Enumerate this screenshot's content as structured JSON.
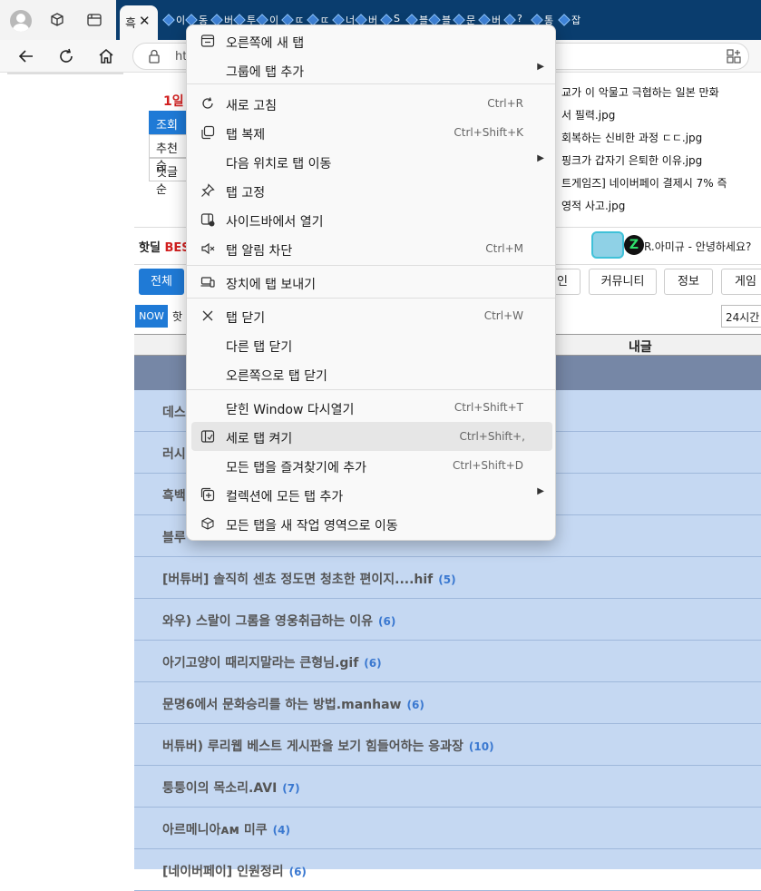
{
  "tabstrip": {
    "active_tab_char": "흑",
    "active_tab_close": "✕",
    "mini_tabs": [
      "이",
      "동",
      "버",
      "투",
      "이",
      "ㄸ",
      "ㄸ",
      "너",
      "버",
      "S",
      "블",
      "블",
      "문",
      "버",
      "?",
      "통",
      "잡"
    ]
  },
  "toolbar": {
    "url_partial": "htt"
  },
  "page": {
    "rank_label": "1일",
    "sort": [
      "조회순",
      "추천순",
      "댓글순"
    ],
    "news": [
      "교가 이 악물고 극협하는 일본 만화",
      "서 필력.jpg",
      "회복하는 신비한 과정 ㄷㄷ.jpg",
      "핑크가 갑자기 은퇴한 이유.jpg",
      "트게임즈] 네이버페이 결제시 7% 즉",
      "영적 사고.jpg"
    ],
    "hotdeal_label_a": "핫딜 ",
    "hotdeal_label_b": "BEST",
    "hotdeal_msg": "R.아미규 - 안녕하세요?",
    "zbadge": "Z",
    "cats": [
      "전체",
      "인",
      "커뮤니티",
      "정보",
      "게임"
    ],
    "now_label": "NOW",
    "now_text": "핫",
    "hours": "24시간",
    "table_header": "내글",
    "rows": [
      {
        "title": "데스",
        "count": ""
      },
      {
        "title": "러시",
        "count": ""
      },
      {
        "title": "흑백",
        "count": ""
      },
      {
        "title": "블루",
        "count": ""
      },
      {
        "title": "[버튜버] 솔직히 센쵸 정도면 청초한 편이지....hif",
        "count": "(5)"
      },
      {
        "title": "와우) 스랄이 그롬을 영웅취급하는 이유",
        "count": "(6)"
      },
      {
        "title": "아기고양이 때리지말라는 큰형님.gif",
        "count": "(6)"
      },
      {
        "title": "문명6에서 문화승리를 하는 방법.manhaw",
        "count": "(6)"
      },
      {
        "title": "버튜버) 루리웹 베스트 게시판을 보기 힘들어하는 응과장",
        "count": "(10)"
      },
      {
        "title": "퉁퉁이의 목소리.AVI",
        "count": "(7)"
      },
      {
        "title": "아르메니아ᴀᴍ 미쿠",
        "count": "(4)"
      },
      {
        "title": "[네이버페이] 인원정리",
        "count": "(6)"
      }
    ]
  },
  "context_menu": {
    "items": [
      {
        "label": "오른쪽에 새 탭",
        "shortcut": "",
        "submenu": false,
        "icon": "new-tab-icon"
      },
      {
        "label": "그룹에 탭 추가",
        "shortcut": "",
        "submenu": true,
        "icon": ""
      },
      {
        "label": "새로 고침",
        "shortcut": "Ctrl+R",
        "submenu": false,
        "icon": "refresh-icon"
      },
      {
        "label": "탭 복제",
        "shortcut": "Ctrl+Shift+K",
        "submenu": false,
        "icon": "duplicate-icon"
      },
      {
        "label": "다음 위치로 탭 이동",
        "shortcut": "",
        "submenu": true,
        "icon": ""
      },
      {
        "label": "탭 고정",
        "shortcut": "",
        "submenu": false,
        "icon": "pin-icon"
      },
      {
        "label": "사이드바에서 열기",
        "shortcut": "",
        "submenu": false,
        "icon": "sidebar-icon"
      },
      {
        "label": "탭 알림 차단",
        "shortcut": "Ctrl+M",
        "submenu": false,
        "icon": "mute-icon"
      },
      {
        "label": "장치에 탭 보내기",
        "shortcut": "",
        "submenu": false,
        "icon": "device-icon"
      },
      {
        "label": "탭 닫기",
        "shortcut": "Ctrl+W",
        "submenu": false,
        "icon": "close-icon"
      },
      {
        "label": "다른 탭 닫기",
        "shortcut": "",
        "submenu": false,
        "icon": ""
      },
      {
        "label": "오른쪽으로 탭 닫기",
        "shortcut": "",
        "submenu": false,
        "icon": ""
      },
      {
        "label": "닫힌 Window 다시열기",
        "shortcut": "Ctrl+Shift+T",
        "submenu": false,
        "icon": ""
      },
      {
        "label": "세로 탭 켜기",
        "shortcut": "Ctrl+Shift+,",
        "submenu": false,
        "icon": "vertical-tabs-icon"
      },
      {
        "label": "모든 탭을 즐겨찾기에 추가",
        "shortcut": "Ctrl+Shift+D",
        "submenu": false,
        "icon": ""
      },
      {
        "label": "컬렉션에 모든 탭 추가",
        "shortcut": "",
        "submenu": true,
        "icon": "collection-icon"
      },
      {
        "label": "모든 탭을 새 작업 영역으로 이동",
        "shortcut": "",
        "submenu": false,
        "icon": "workspace-icon"
      }
    ],
    "highlighted_index": 13
  },
  "colors": {
    "tabstrip_bg": "#0a3d6e",
    "accent": "#1f7ad6",
    "list_bg": "#c5d8f2",
    "list_band": "#7687a6",
    "hot_red": "#d21f1f"
  }
}
